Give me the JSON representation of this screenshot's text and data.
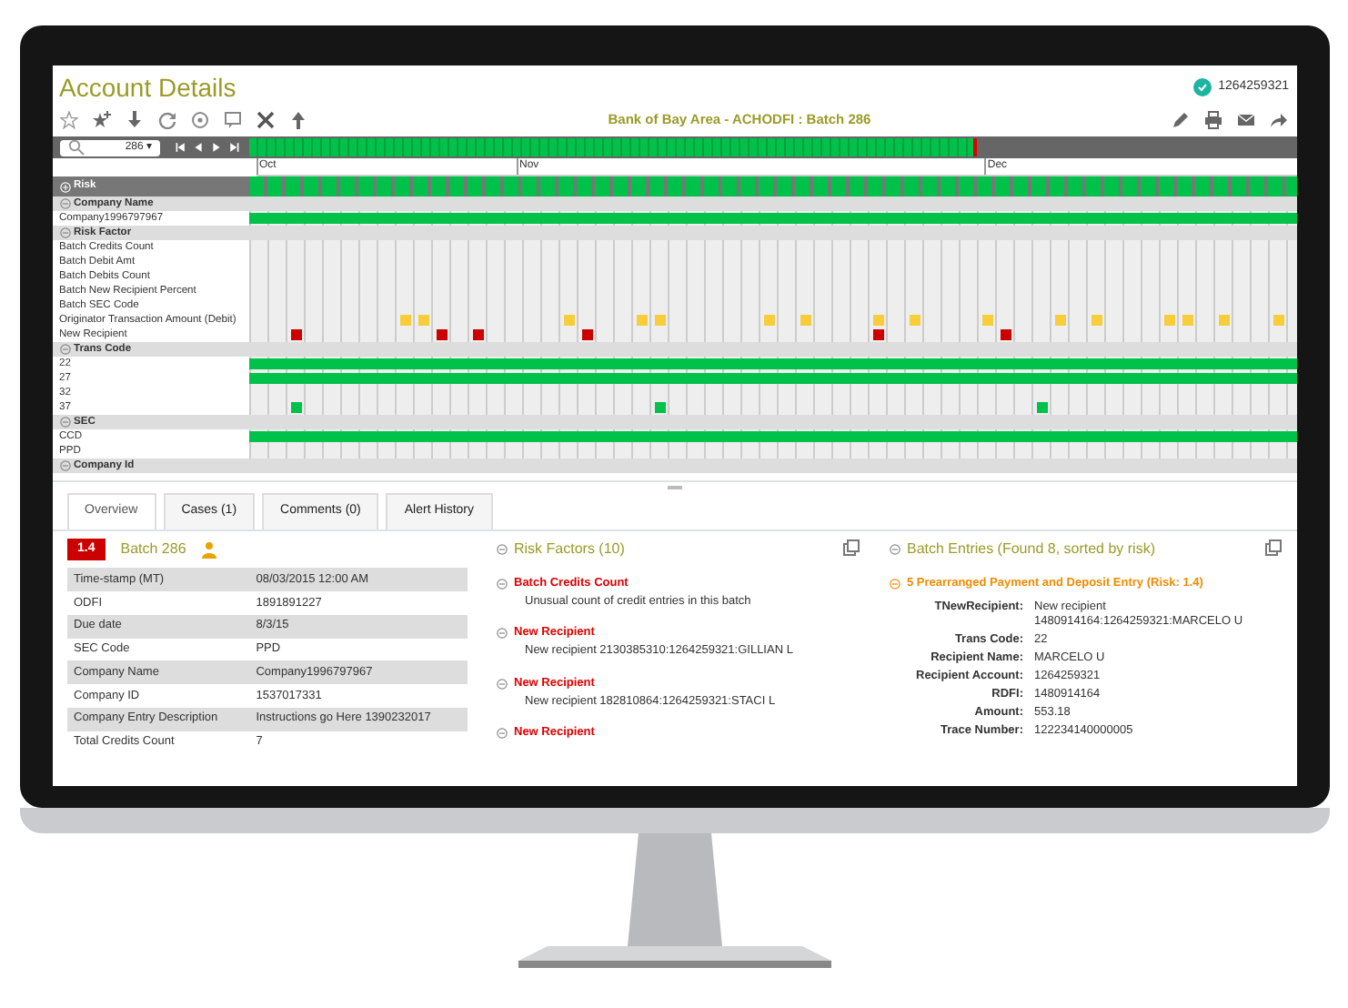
{
  "header": {
    "title": "Account Details",
    "user": "1264259321",
    "subtitle": "Bank of Bay Area - ACHODFI : Batch 286"
  },
  "scrubber": {
    "batch": "286 ▾",
    "level": 0.7
  },
  "months": [
    "Oct",
    "Nov",
    "Dec"
  ],
  "timeline": {
    "title": "Risk",
    "groups": [
      {
        "label": "Company Name",
        "rows": [
          {
            "label": "Company1996797967",
            "bar": true
          }
        ]
      },
      {
        "label": "Risk Factor",
        "rows": [
          {
            "label": "Batch Credits Count"
          },
          {
            "label": "Batch Debit Amt"
          },
          {
            "label": "Batch Debits Count"
          },
          {
            "label": "Batch New Recipient Percent"
          },
          {
            "label": "Batch SEC Code"
          },
          {
            "label": "Originator Transaction Amount (Debit)",
            "cells": [
              {
                "filled": false
              },
              {
                "filled": false
              },
              {
                "filled": false
              },
              {
                "filled": false
              },
              {
                "filled": false
              },
              {
                "filled": false
              },
              {
                "filled": false
              },
              {
                "filled": false
              },
              {
                "filled": true,
                "color": "#f7cd3a"
              },
              {
                "filled": true,
                "color": "#f7cd3a"
              },
              {
                "filled": false
              },
              {
                "filled": false
              },
              {
                "filled": false
              },
              {
                "filled": false
              },
              {
                "filled": false
              },
              {
                "filled": false
              },
              {
                "filled": false
              },
              {
                "filled": true,
                "color": "#f7cd3a"
              },
              {
                "filled": false
              },
              {
                "filled": false
              },
              {
                "filled": false
              },
              {
                "filled": true,
                "color": "#f7cd3a"
              },
              {
                "filled": true,
                "color": "#f7cd3a"
              },
              {
                "filled": false
              },
              {
                "filled": false
              },
              {
                "filled": false
              },
              {
                "filled": false
              },
              {
                "filled": false
              },
              {
                "filled": true,
                "color": "#f7cd3a"
              },
              {
                "filled": false
              },
              {
                "filled": true,
                "color": "#f7cd3a"
              },
              {
                "filled": false
              },
              {
                "filled": false
              },
              {
                "filled": false
              },
              {
                "filled": true,
                "color": "#f7cd3a"
              },
              {
                "filled": false
              },
              {
                "filled": true,
                "color": "#f7cd3a"
              },
              {
                "filled": false
              },
              {
                "filled": false
              },
              {
                "filled": false
              },
              {
                "filled": true,
                "color": "#f7cd3a"
              },
              {
                "filled": false
              },
              {
                "filled": false
              },
              {
                "filled": false
              },
              {
                "filled": true,
                "color": "#f7cd3a"
              },
              {
                "filled": false
              },
              {
                "filled": true,
                "color": "#f7cd3a"
              },
              {
                "filled": false
              },
              {
                "filled": false
              },
              {
                "filled": false
              },
              {
                "filled": true,
                "color": "#f7cd3a"
              },
              {
                "filled": true,
                "color": "#f7cd3a"
              },
              {
                "filled": false
              },
              {
                "filled": true,
                "color": "#f7cd3a"
              },
              {
                "filled": false
              },
              {
                "filled": false
              },
              {
                "filled": true,
                "color": "#f7cd3a"
              }
            ]
          },
          {
            "label": "New Recipient",
            "cells": [
              {
                "filled": false
              },
              {
                "filled": false
              },
              {
                "filled": true,
                "color": "#cc0000"
              },
              {
                "filled": false
              },
              {
                "filled": false
              },
              {
                "filled": false
              },
              {
                "filled": false
              },
              {
                "filled": false
              },
              {
                "filled": false
              },
              {
                "filled": false
              },
              {
                "filled": true,
                "color": "#cc0000"
              },
              {
                "filled": false
              },
              {
                "filled": true,
                "color": "#cc0000"
              },
              {
                "filled": false
              },
              {
                "filled": false
              },
              {
                "filled": false
              },
              {
                "filled": false
              },
              {
                "filled": false
              },
              {
                "filled": true,
                "color": "#cc0000"
              },
              {
                "filled": false
              },
              {
                "filled": false
              },
              {
                "filled": false
              },
              {
                "filled": false
              },
              {
                "filled": false
              },
              {
                "filled": false
              },
              {
                "filled": false
              },
              {
                "filled": false
              },
              {
                "filled": false
              },
              {
                "filled": false
              },
              {
                "filled": false
              },
              {
                "filled": false
              },
              {
                "filled": false
              },
              {
                "filled": false
              },
              {
                "filled": false
              },
              {
                "filled": true,
                "color": "#cc0000"
              },
              {
                "filled": false
              },
              {
                "filled": false
              },
              {
                "filled": false
              },
              {
                "filled": false
              },
              {
                "filled": false
              },
              {
                "filled": false
              },
              {
                "filled": true,
                "color": "#cc0000"
              }
            ]
          }
        ]
      },
      {
        "label": "Trans Code",
        "rows": [
          {
            "label": "22",
            "bar": true
          },
          {
            "label": "27",
            "bar": true
          },
          {
            "label": "32"
          },
          {
            "label": "37",
            "cells": [
              {
                "filled": false
              },
              {
                "filled": false
              },
              {
                "filled": true,
                "color": "#00c24a"
              },
              {
                "filled": false
              },
              {
                "filled": false
              },
              {
                "filled": false
              },
              {
                "filled": false
              },
              {
                "filled": false
              },
              {
                "filled": false
              },
              {
                "filled": false
              },
              {
                "filled": false
              },
              {
                "filled": false
              },
              {
                "filled": false
              },
              {
                "filled": false
              },
              {
                "filled": false
              },
              {
                "filled": false
              },
              {
                "filled": false
              },
              {
                "filled": false
              },
              {
                "filled": false
              },
              {
                "filled": false
              },
              {
                "filled": false
              },
              {
                "filled": false
              },
              {
                "filled": true,
                "color": "#00c24a"
              },
              {
                "filled": false
              },
              {
                "filled": false
              },
              {
                "filled": false
              },
              {
                "filled": false
              },
              {
                "filled": false
              },
              {
                "filled": false
              },
              {
                "filled": false
              },
              {
                "filled": false
              },
              {
                "filled": false
              },
              {
                "filled": false
              },
              {
                "filled": false
              },
              {
                "filled": false
              },
              {
                "filled": false
              },
              {
                "filled": false
              },
              {
                "filled": false
              },
              {
                "filled": false
              },
              {
                "filled": false
              },
              {
                "filled": false
              },
              {
                "filled": false
              },
              {
                "filled": false
              },
              {
                "filled": true,
                "color": "#00c24a"
              }
            ]
          }
        ]
      },
      {
        "label": "SEC",
        "rows": [
          {
            "label": "CCD",
            "bar": true
          },
          {
            "label": "PPD"
          }
        ]
      },
      {
        "label": "Company Id"
      }
    ]
  },
  "tabs": [
    {
      "label": "Overview",
      "selected": true
    },
    {
      "label": "Cases (1)",
      "selected": false
    },
    {
      "label": "Comments (0)",
      "selected": false
    },
    {
      "label": "Alert History",
      "selected": false
    }
  ],
  "batch": {
    "risk": "1.4",
    "title": "Batch 286",
    "fields": [
      {
        "label": "Time-stamp (MT)",
        "value": "08/03/2015 12:00 AM"
      },
      {
        "label": "ODFI",
        "value": "1891891227"
      },
      {
        "label": "Due date",
        "value": "8/3/15"
      },
      {
        "label": "SEC Code",
        "value": "PPD"
      },
      {
        "label": "Company Name",
        "value": "Company1996797967"
      },
      {
        "label": "Company ID",
        "value": "1537017331"
      },
      {
        "label": "Company Entry Description",
        "value": "Instructions go Here 1390232017"
      },
      {
        "label": "Total Credits Count",
        "value": "7"
      }
    ]
  },
  "risk_factors": {
    "title": "Risk Factors (10)",
    "items": [
      {
        "name": "Batch Credits Count",
        "detail": "Unusual count of credit entries in this batch"
      },
      {
        "name": "New Recipient",
        "detail": "New recipient 2130385310:1264259321:GILLIAN L"
      },
      {
        "name": "New Recipient",
        "detail": "New recipient 182810864:1264259321:STACI L"
      },
      {
        "name": "New Recipient"
      }
    ]
  },
  "batch_entries": {
    "title": "Batch Entries (Found 8, sorted by risk)",
    "entry": "5  Prearranged Payment and Deposit Entry (Risk: 1.4)",
    "fields": [
      {
        "label": "TNewRecipient:",
        "value": "New recipient 1480914164:1264259321:MARCELO U"
      },
      {
        "label": "Trans Code:",
        "value": "22"
      },
      {
        "label": "Recipient Name:",
        "value": "MARCELO U"
      },
      {
        "label": "Recipient Account:",
        "value": "1264259321"
      },
      {
        "label": "RDFI:",
        "value": "1480914164"
      },
      {
        "label": "Amount:",
        "value": "553.18"
      },
      {
        "label": "Trace Number:",
        "value": "122234140000005"
      }
    ]
  }
}
